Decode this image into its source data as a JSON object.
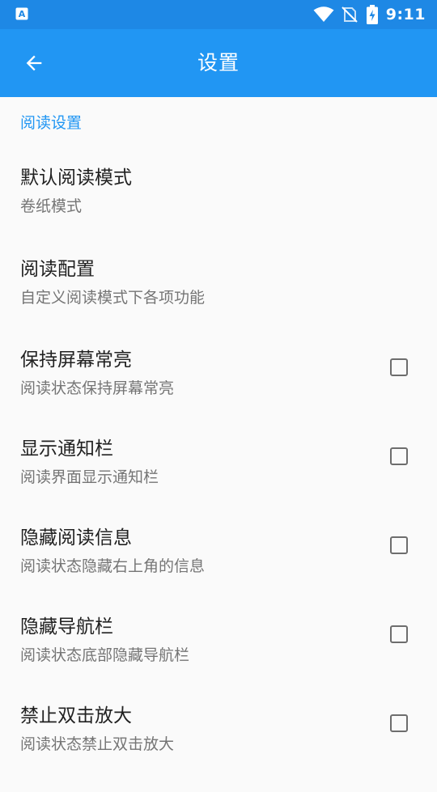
{
  "status_bar": {
    "time": "9:11",
    "icons": [
      "app-notification-icon",
      "wifi-icon",
      "no-sim-icon",
      "battery-charging-icon"
    ]
  },
  "app_bar": {
    "title": "设置",
    "back_icon": "arrow-back-icon"
  },
  "category": {
    "label": "阅读设置"
  },
  "items": [
    {
      "title": "默认阅读模式",
      "summary": "卷纸模式",
      "checkbox": false
    },
    {
      "title": "阅读配置",
      "summary": "自定义阅读模式下各项功能",
      "checkbox": false
    },
    {
      "title": "保持屏幕常亮",
      "summary": "阅读状态保持屏幕常亮",
      "checkbox": true,
      "checked": false
    },
    {
      "title": "显示通知栏",
      "summary": "阅读界面显示通知栏",
      "checkbox": true,
      "checked": false
    },
    {
      "title": "隐藏阅读信息",
      "summary": "阅读状态隐藏右上角的信息",
      "checkbox": true,
      "checked": false
    },
    {
      "title": "隐藏导航栏",
      "summary": "阅读状态底部隐藏导航栏",
      "checkbox": true,
      "checked": false
    },
    {
      "title": "禁止双击放大",
      "summary": "阅读状态禁止双击放大",
      "checkbox": true,
      "checked": false
    }
  ],
  "colors": {
    "status_bar": "#1e88e5",
    "app_bar": "#2196f3",
    "accent": "#2196f3",
    "background": "#fafafa"
  }
}
